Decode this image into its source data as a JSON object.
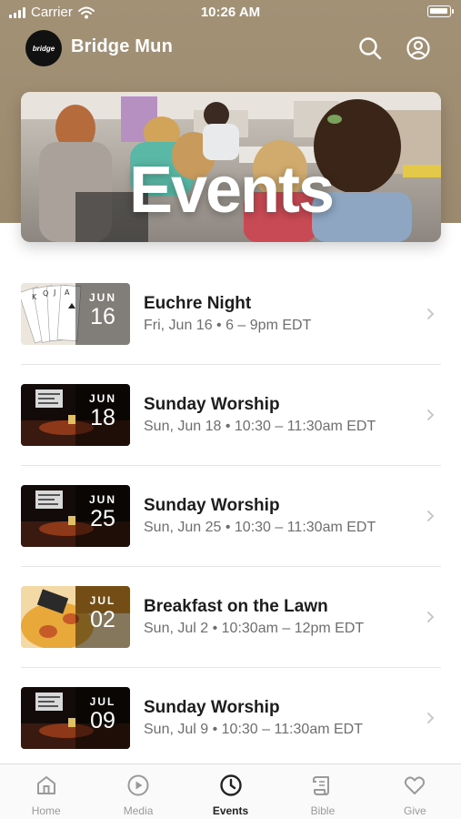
{
  "status_bar": {
    "carrier": "Carrier",
    "time": "10:26 AM"
  },
  "header": {
    "logo_text": "bridge",
    "app_title": "Bridge Mun"
  },
  "hero": {
    "title": "Events"
  },
  "events": [
    {
      "title": "Euchre Night",
      "month": "JUN",
      "day": "16",
      "meta": "Fri, Jun 16 • 6 – 9pm EDT",
      "thumb": "cards"
    },
    {
      "title": "Sunday Worship",
      "month": "JUN",
      "day": "18",
      "meta": "Sun, Jun 18 • 10:30 – 11:30am EDT",
      "thumb": "worship"
    },
    {
      "title": "Sunday Worship",
      "month": "JUN",
      "day": "25",
      "meta": "Sun, Jun 25 • 10:30 – 11:30am EDT",
      "thumb": "worship"
    },
    {
      "title": "Breakfast on the Lawn",
      "month": "JUL",
      "day": "02",
      "meta": "Sun, Jul 2 • 10:30am – 12pm EDT",
      "thumb": "breakfast"
    },
    {
      "title": "Sunday Worship",
      "month": "JUL",
      "day": "09",
      "meta": "Sun, Jul 9 • 10:30 – 11:30am EDT",
      "thumb": "worship"
    }
  ],
  "tabs": [
    {
      "label": "Home",
      "icon": "home-icon"
    },
    {
      "label": "Media",
      "icon": "play-icon"
    },
    {
      "label": "Events",
      "icon": "clock-icon",
      "active": true
    },
    {
      "label": "Bible",
      "icon": "scroll-icon"
    },
    {
      "label": "Give",
      "icon": "heart-icon"
    }
  ],
  "colors": {
    "header_band": "#a39176",
    "active_tab": "#222222",
    "inactive_tab": "#9a9a9a"
  }
}
